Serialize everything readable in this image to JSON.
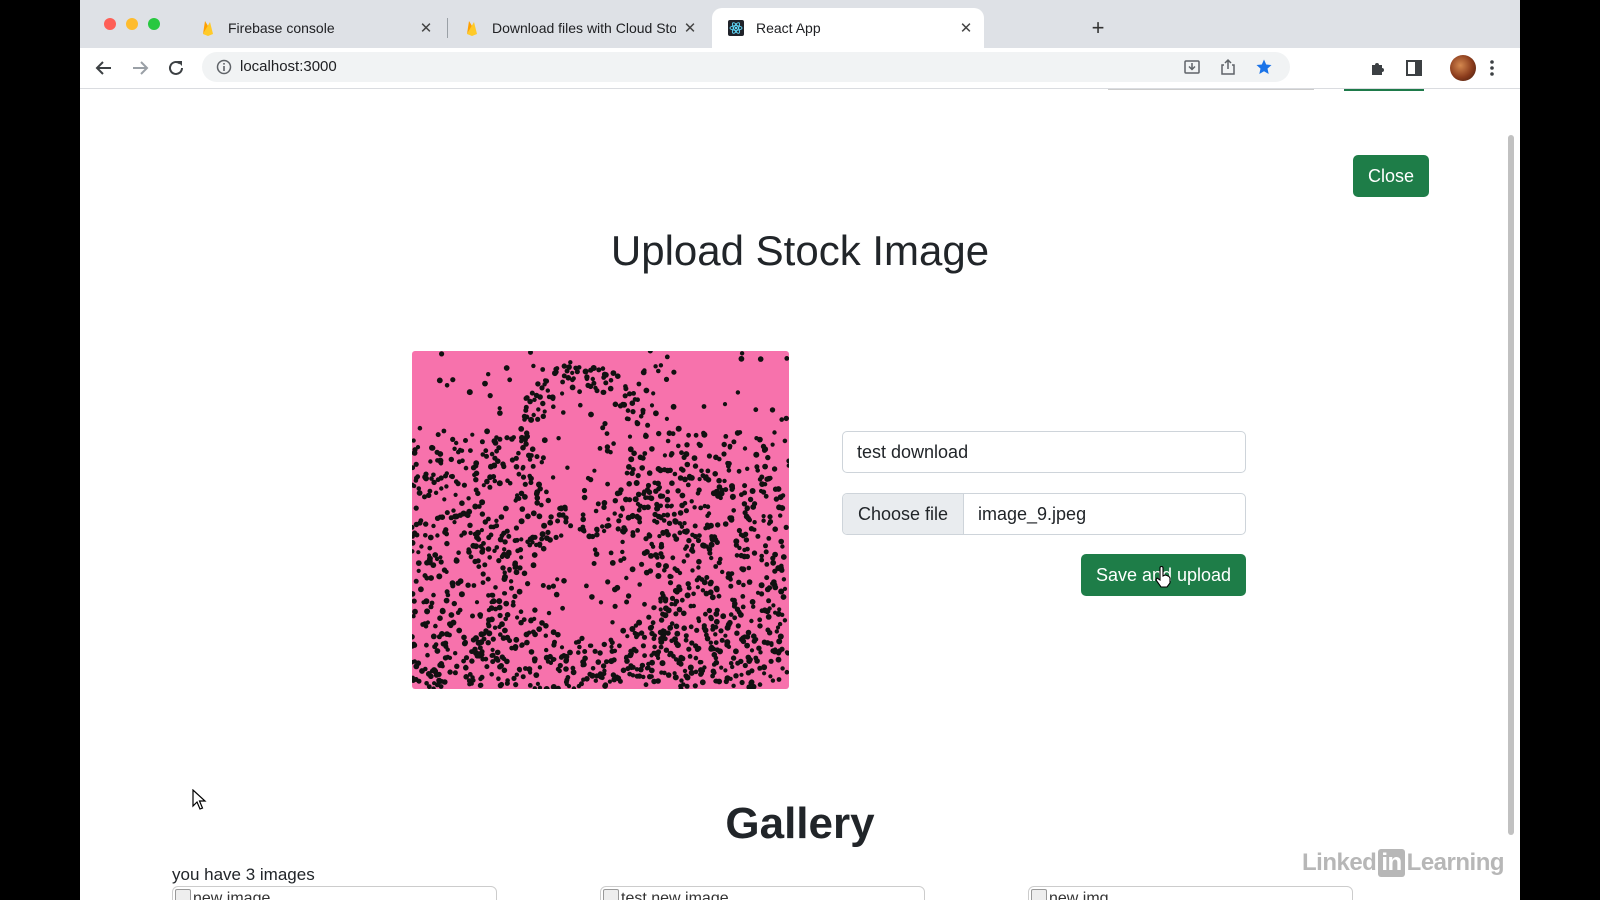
{
  "browser": {
    "tabs": [
      {
        "title": "Firebase console",
        "active": false
      },
      {
        "title": "Download files with Cloud Stor",
        "active": false
      },
      {
        "title": "React App",
        "active": true
      }
    ],
    "url": "localhost:3000"
  },
  "page": {
    "close_label": "Close",
    "upload_title": "Upload Stock Image",
    "name_input_value": "test download",
    "file_button_label": "Choose file",
    "file_name": "image_9.jpeg",
    "save_label": "Save and upload",
    "gallery_title": "Gallery",
    "image_count_text": "you have 3 images",
    "gallery_items": [
      {
        "alt": "new image"
      },
      {
        "alt": "test new image"
      },
      {
        "alt": "new img"
      }
    ]
  },
  "watermark": {
    "left": "Linked",
    "badge": "in",
    "right": "Learning"
  },
  "colors": {
    "accent_green": "#1e7d48",
    "preview_bg": "#f772ac",
    "tabstrip_bg": "#dee1e6"
  }
}
